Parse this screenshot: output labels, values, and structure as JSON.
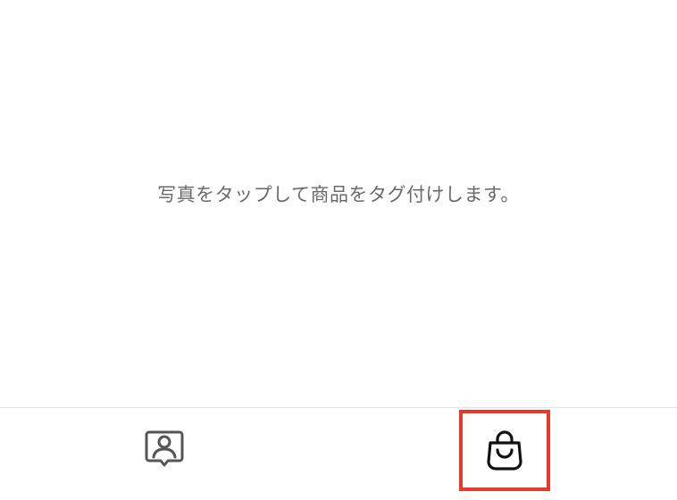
{
  "main": {
    "hint_text": "写真をタップして商品をタグ付けします。"
  },
  "tabbar": {
    "tabs": [
      {
        "icon": "tag-people-icon",
        "state": "unselected"
      },
      {
        "icon": "shopping-bag-icon",
        "state": "highlighted"
      }
    ]
  },
  "colors": {
    "background": "#ffffff",
    "hint_text": "#6a6a6a",
    "divider": "#e3e3e3",
    "people_icon": "#555555",
    "bag_icon": "#111111",
    "highlight_border": "#e8382a"
  }
}
